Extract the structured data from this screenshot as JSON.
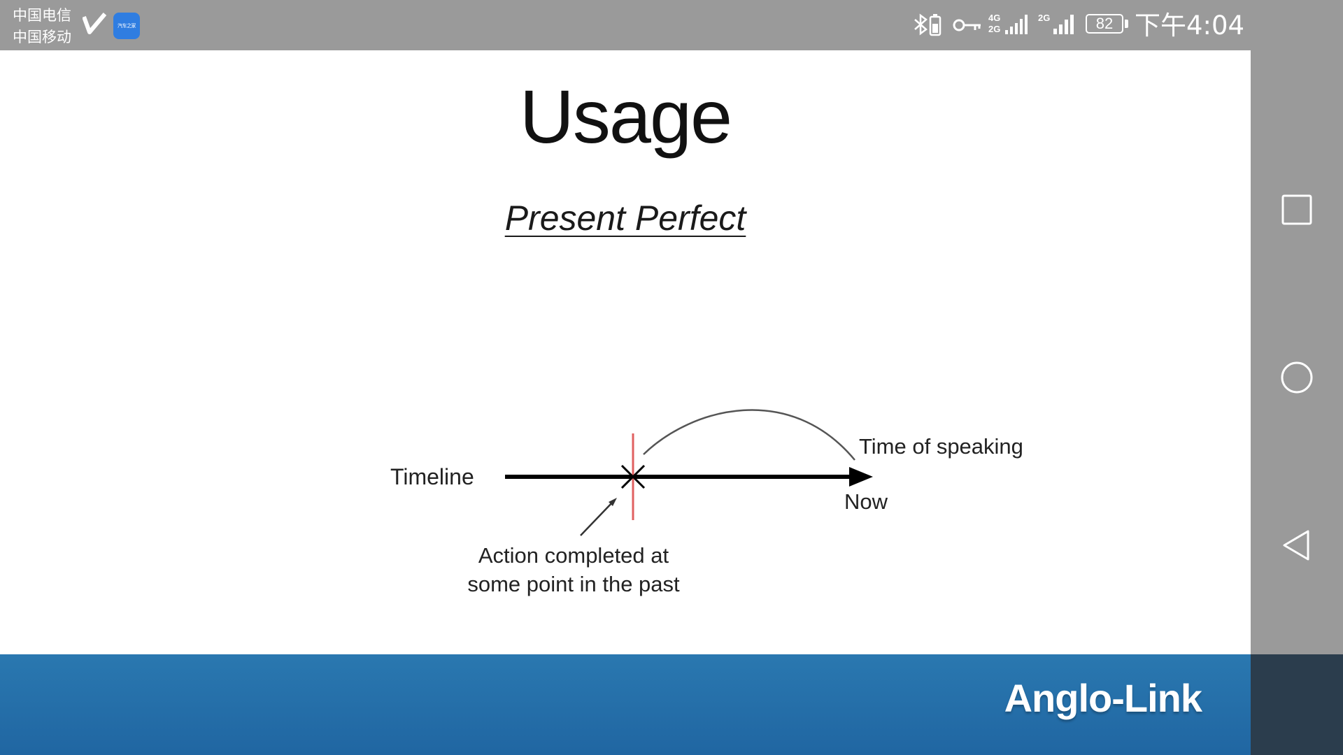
{
  "status_bar": {
    "carrier_1": "中国电信",
    "carrier_2": "中国移动",
    "app_icon_text": "汽车之家",
    "network_1": "4G",
    "network_1b": "2G",
    "network_2": "2G",
    "battery_level": "82",
    "time": "下午4:04"
  },
  "slide": {
    "title": "Usage",
    "subtitle": "Present Perfect",
    "diagram": {
      "timeline_label": "Timeline",
      "time_of_speaking_label": "Time of speaking",
      "now_label": "Now",
      "action_label_line1": "Action completed at",
      "action_label_line2": "some point in the past"
    },
    "brand": "Anglo-Link"
  },
  "colors": {
    "status_bar_bg": "#9a9a9a",
    "slide_bg": "#ffffff",
    "footer_blue": "#2570ab",
    "marker_red": "#e06060"
  },
  "nav_bar": {
    "icons": [
      "recent-apps-icon",
      "home-icon",
      "back-icon"
    ]
  }
}
